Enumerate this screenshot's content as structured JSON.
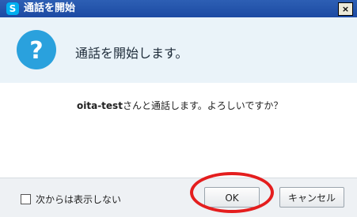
{
  "window": {
    "title": "通話を開始",
    "app_icon_glyph": "S",
    "close_glyph": "×"
  },
  "header": {
    "icon": "question-icon",
    "heading": "通話を開始します。"
  },
  "message": {
    "name": "oita-test",
    "text": "さんと通話します。よろしいですか？"
  },
  "footer": {
    "checkbox_label": "次からは表示しない",
    "checkbox_checked": false,
    "ok_label": "OK",
    "cancel_label": "キャンセル"
  },
  "colors": {
    "titlebar": "#1c4aa3",
    "header_bg": "#eaf3f9",
    "question_icon": "#2aa1dd",
    "highlight": "#e41e1e"
  }
}
